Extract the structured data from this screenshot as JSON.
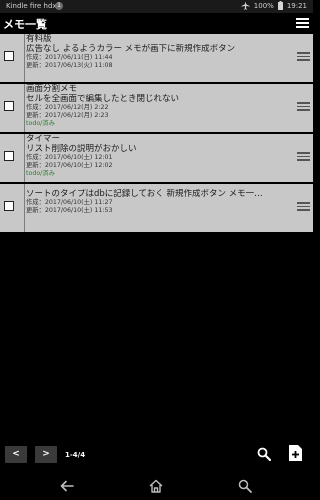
{
  "status_bar": {
    "device_name": "Kindle fire hdx",
    "notification_count": "1",
    "battery": "100%",
    "time": "19:21"
  },
  "app_bar": {
    "title": "メモ一覧",
    "menu_icon": "hamburger-menu-icon"
  },
  "memos": [
    {
      "title": "有料版",
      "body": "広告なし よるようカラー メモが画下に新規作成ボタン",
      "created": "作成：2017/06/11(日) 11:44",
      "updated": "更新：2017/06/13(火) 11:08",
      "tag": ""
    },
    {
      "title": "画面分割メモ",
      "body": "セルを全画面で編集したとき閉じれない",
      "created": "作成：2017/06/12(月) 2:22",
      "updated": "更新：2017/06/12(月) 2:23",
      "tag": "todo/済み"
    },
    {
      "title": "タイマー",
      "body": "リスト削除の説明がおかしい",
      "created": "作成：2017/06/10(土) 12:01",
      "updated": "更新：2017/06/10(土) 12:02",
      "tag": "todo/済み"
    },
    {
      "title": "",
      "body": "ソートのタイプはdbに記録しておく 新規作成ボタン メモ一…",
      "created": "作成：2017/06/10(土) 11:27",
      "updated": "更新：2017/06/10(土) 11:53",
      "tag": ""
    }
  ],
  "pager": {
    "prev_label": "<",
    "next_label": ">",
    "count_label": "1-4/4"
  },
  "toolbar": {
    "search_icon": "search-icon",
    "new_icon": "new-memo-icon"
  },
  "nav": {
    "back_icon": "back-arrow-icon",
    "home_icon": "home-icon",
    "search_icon": "search-icon"
  },
  "colors": {
    "item_bg": "#c8c8c8",
    "tag_green": "#2f7d2f",
    "pager_button": "#3a3a3a"
  }
}
